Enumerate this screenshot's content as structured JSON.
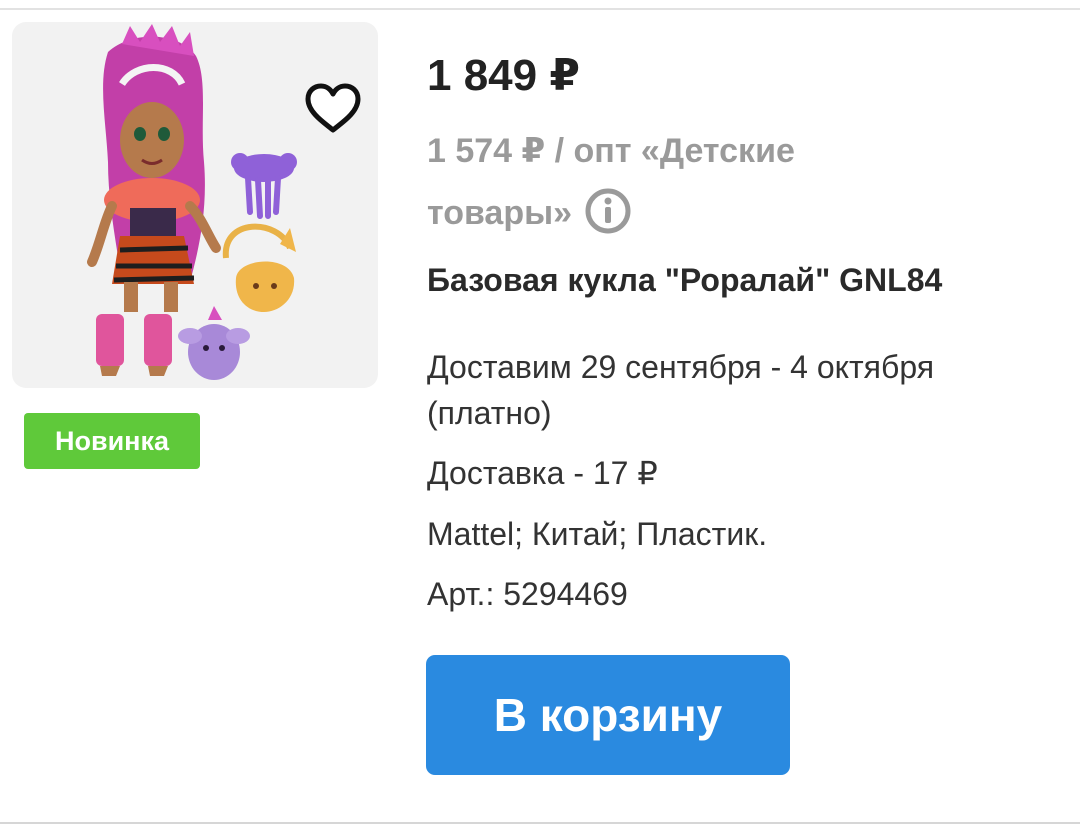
{
  "product": {
    "price": "1 849 ₽",
    "wholesale_price": "1 574 ₽ / опт «Детские товары»",
    "title": "Базовая кукла \"Роралай\" GNL84",
    "delivery_date": "Доставим 29 сентября - 4 октября (платно)",
    "delivery_cost": "Доставка - 17 ₽",
    "specs": "Mattel; Китай; Пластик.",
    "sku": "Арт.: 5294469",
    "badge": "Новинка",
    "image_name": "doll-with-accessories-image"
  },
  "actions": {
    "cart_label": "В корзину"
  },
  "icons": {
    "favorite": "heart-icon",
    "info": "info-icon"
  },
  "colors": {
    "badge_green": "#5fc93a",
    "button_blue": "#2a8ae0",
    "muted_gray": "#9a9a9a"
  }
}
